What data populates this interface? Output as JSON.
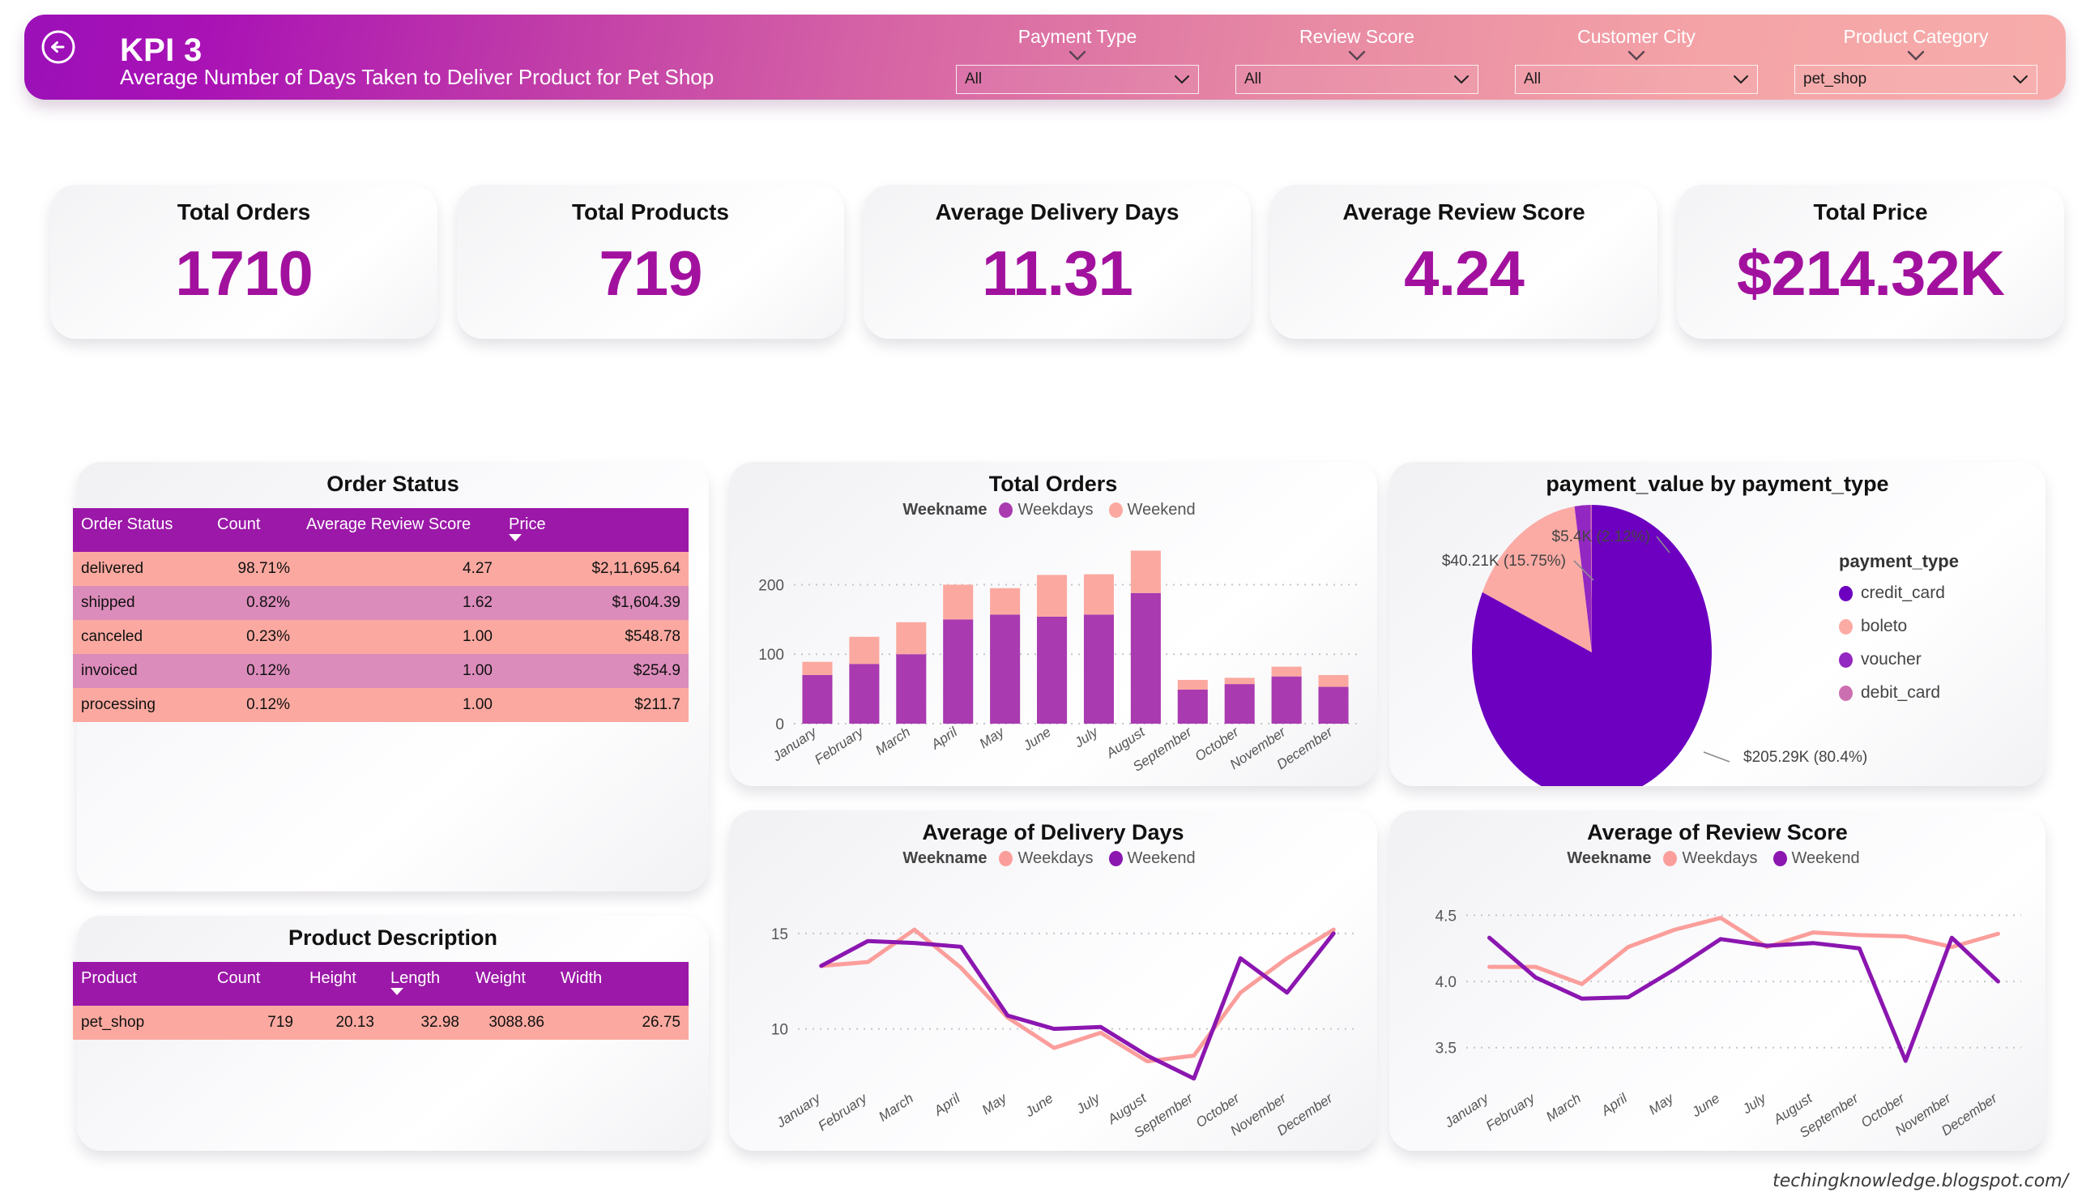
{
  "header": {
    "back_icon": "back-arrow-circle-icon",
    "title": "KPI 3",
    "subtitle": "Average Number of Days Taken to Deliver Product for Pet Shop",
    "filters": [
      {
        "label": "Payment Type",
        "value": "All",
        "icon": "chevron-down-icon"
      },
      {
        "label": "Review Score",
        "value": "All",
        "icon": "chevron-down-icon"
      },
      {
        "label": "Customer City",
        "value": "All",
        "icon": "chevron-down-icon"
      },
      {
        "label": "Product Category",
        "value": "pet_shop",
        "icon": "chevron-down-icon"
      }
    ]
  },
  "kpis": [
    {
      "label": "Total Orders",
      "value": "1710"
    },
    {
      "label": "Total Products",
      "value": "719"
    },
    {
      "label": "Average Delivery Days",
      "value": "11.31"
    },
    {
      "label": "Average Review Score",
      "value": "4.24"
    },
    {
      "label": "Total Price",
      "value": "$214.32K"
    }
  ],
  "order_status": {
    "title": "Order Status",
    "columns": [
      "Order Status",
      "Count",
      "Average Review Score",
      "Price"
    ],
    "sorted_column": "Price",
    "rows": [
      [
        "delivered",
        "98.71%",
        "4.27",
        "$2,11,695.64"
      ],
      [
        "shipped",
        "0.82%",
        "1.62",
        "$1,604.39"
      ],
      [
        "canceled",
        "0.23%",
        "1.00",
        "$548.78"
      ],
      [
        "invoiced",
        "0.12%",
        "1.00",
        "$254.9"
      ],
      [
        "processing",
        "0.12%",
        "1.00",
        "$211.7"
      ]
    ]
  },
  "product_description": {
    "title": "Product Description",
    "columns": [
      "Product",
      "Count",
      "Height",
      "Length",
      "Weight",
      "Width"
    ],
    "sorted_column": "Length",
    "rows": [
      [
        "pet_shop",
        "719",
        "20.13",
        "32.98",
        "3088.86",
        "26.75"
      ]
    ]
  },
  "colors": {
    "weekdays_bar": "#a93ab0",
    "weekend_bar": "#fba9a0",
    "weekdays_line": "#fb9e9b",
    "weekend_line": "#8b16b0",
    "credit_card": "#6d00c0",
    "boleto": "#fbaaa4",
    "voucher": "#9327c2",
    "debit_card": "#cc6fb0",
    "kpi_value": "#a2119e",
    "table_header": "#9b18a8"
  },
  "watermark": "techingknowledge.blogspot.com/",
  "chart_data": [
    {
      "type": "bar",
      "id": "total-orders",
      "title": "Total Orders",
      "stacked": true,
      "legend_title": "Weekname",
      "legend_position": "top",
      "categories": [
        "January",
        "February",
        "March",
        "April",
        "May",
        "June",
        "July",
        "August",
        "September",
        "October",
        "November",
        "December"
      ],
      "series": [
        {
          "name": "Weekdays",
          "color": "#a93ab0",
          "values": [
            70,
            86,
            100,
            150,
            157,
            154,
            157,
            188,
            49,
            57,
            68,
            53
          ]
        },
        {
          "name": "Weekend",
          "color": "#fba9a0",
          "values": [
            19,
            39,
            46,
            50,
            38,
            60,
            58,
            61,
            14,
            9,
            14,
            17
          ]
        }
      ],
      "xlabel": "",
      "ylabel": "",
      "ylim": [
        0,
        260
      ],
      "yticks": [
        0,
        100,
        200
      ],
      "grid": true
    },
    {
      "type": "pie",
      "id": "payment-value-by-payment-type",
      "title": "payment_value by payment_type",
      "legend_title": "payment_type",
      "legend_position": "right",
      "categories": [
        "credit_card",
        "boleto",
        "voucher",
        "debit_card"
      ],
      "values": [
        205.29,
        40.21,
        5.4,
        0.4
      ],
      "percentages": [
        80.4,
        15.75,
        2.12,
        1.73
      ],
      "colors": [
        "#6d00c0",
        "#fbaaa4",
        "#9327c2",
        "#cc6fb0"
      ],
      "labels": [
        "$205.29K (80.4%)",
        "$40.21K (15.75%)",
        "$5.4K (2.12%)"
      ],
      "grid": false
    },
    {
      "type": "line",
      "id": "average-of-delivery-days",
      "title": "Average of Delivery Days",
      "legend_title": "Weekname",
      "legend_position": "top",
      "categories": [
        "January",
        "February",
        "March",
        "April",
        "May",
        "June",
        "July",
        "August",
        "September",
        "October",
        "November",
        "December"
      ],
      "series": [
        {
          "name": "Weekdays",
          "color": "#fb9e9b",
          "values": [
            13.3,
            13.5,
            15.2,
            13.2,
            10.6,
            9.0,
            9.8,
            8.3,
            8.6,
            11.9,
            13.7,
            15.2
          ]
        },
        {
          "name": "Weekend",
          "color": "#8b16b0",
          "values": [
            13.3,
            14.6,
            14.5,
            14.3,
            10.7,
            10.0,
            10.1,
            8.6,
            7.4,
            13.7,
            11.9,
            15.0
          ]
        }
      ],
      "xlabel": "",
      "ylabel": "",
      "ylim": [
        6.8,
        17.2
      ],
      "yticks": [
        10,
        15
      ],
      "grid": true
    },
    {
      "type": "line",
      "id": "average-of-review-score",
      "title": "Average of Review Score",
      "legend_title": "Weekname",
      "legend_position": "top",
      "categories": [
        "January",
        "February",
        "March",
        "April",
        "May",
        "June",
        "July",
        "August",
        "September",
        "October",
        "November",
        "December"
      ],
      "series": [
        {
          "name": "Weekdays",
          "color": "#fb9e9b",
          "values": [
            4.11,
            4.11,
            3.98,
            4.26,
            4.39,
            4.48,
            4.26,
            4.37,
            4.35,
            4.34,
            4.26,
            4.36
          ]
        },
        {
          "name": "Weekend",
          "color": "#8b16b0",
          "values": [
            4.33,
            4.03,
            3.87,
            3.88,
            4.09,
            4.32,
            4.27,
            4.29,
            4.25,
            3.4,
            4.33,
            4.0
          ]
        }
      ],
      "xlabel": "",
      "ylabel": "",
      "ylim": [
        3.18,
        4.68
      ],
      "yticks": [
        3.5,
        4.0,
        4.5
      ],
      "grid": true
    }
  ]
}
